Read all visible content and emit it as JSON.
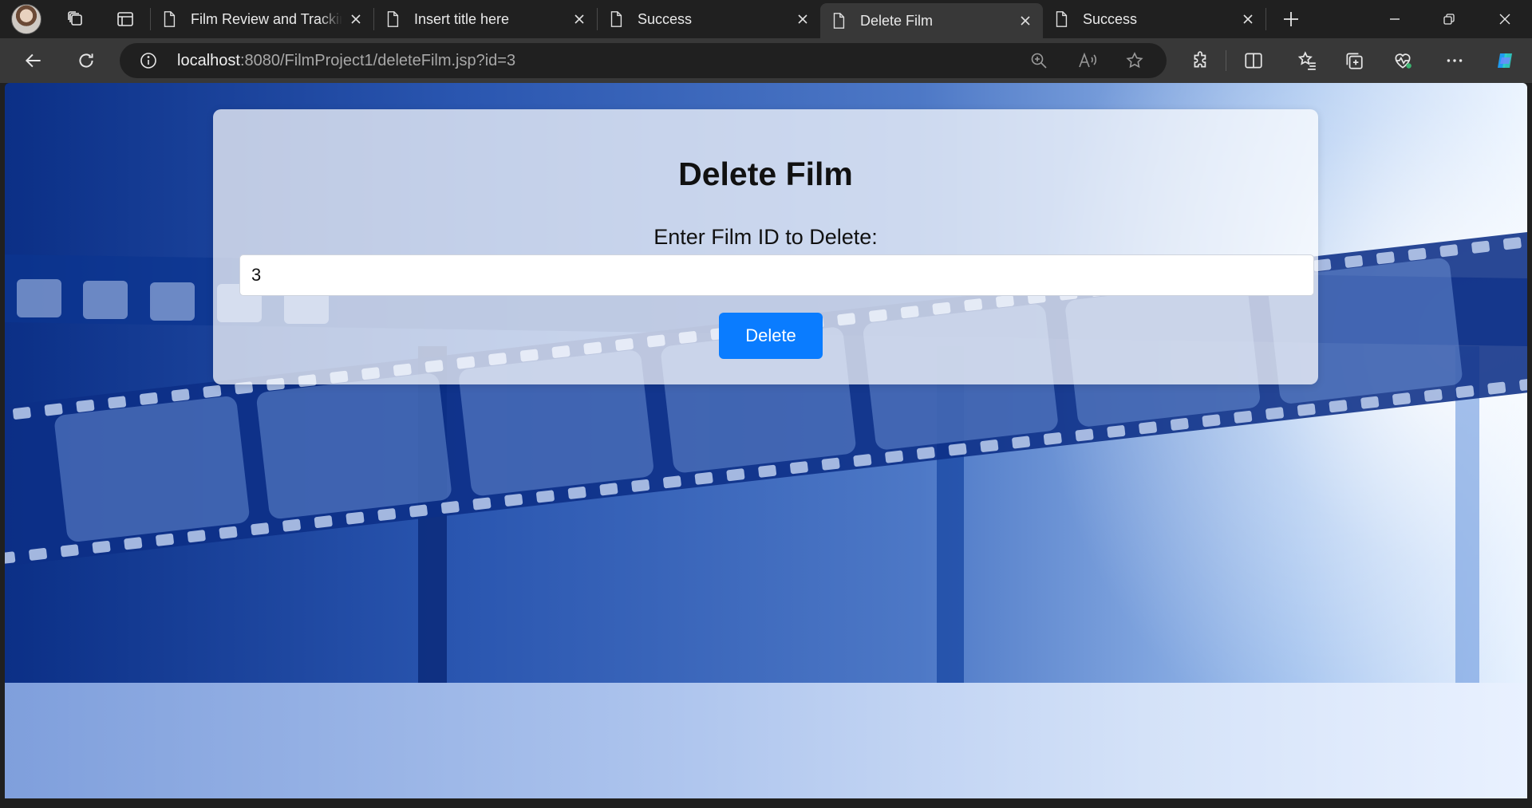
{
  "browser": {
    "tabs": [
      {
        "title": "Film Review and Tracking"
      },
      {
        "title": "Insert title here"
      },
      {
        "title": "Success"
      },
      {
        "title": "Delete Film"
      },
      {
        "title": "Success"
      }
    ],
    "active_tab_index": 3,
    "url_host": "localhost",
    "url_path": ":8080/FilmProject1/deleteFilm.jsp?id=3"
  },
  "page": {
    "heading": "Delete Film",
    "field_label": "Enter Film ID to Delete:",
    "film_id_value": "3",
    "delete_button": "Delete"
  },
  "colors": {
    "button": "#0a7cff",
    "tab_strip": "#202020",
    "toolbar": "#383838"
  }
}
